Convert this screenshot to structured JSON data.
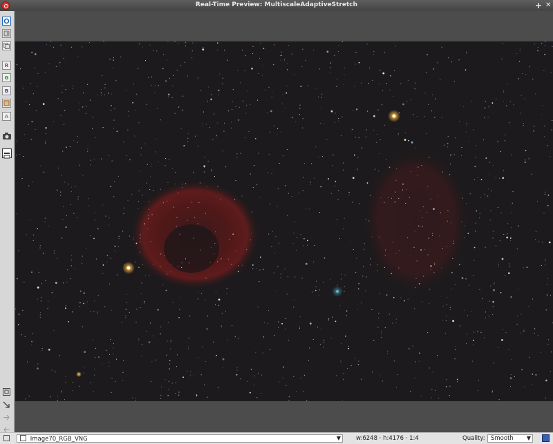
{
  "window": {
    "title": "Real-Time Preview: MultiscaleAdaptiveStretch"
  },
  "titlebar_buttons": {
    "pin": "+",
    "close": "✕"
  },
  "toolbar": {
    "tools": [
      {
        "name": "zoom-fit-tool",
        "label": ""
      },
      {
        "name": "view-split-tool",
        "label": ""
      },
      {
        "name": "view-compare-tool",
        "label": ""
      },
      {
        "name": "channel-r-tool",
        "label": "R"
      },
      {
        "name": "channel-g-tool",
        "label": "G"
      },
      {
        "name": "channel-b-tool",
        "label": "B"
      },
      {
        "name": "channel-rgb-tool",
        "label": ""
      },
      {
        "name": "channel-alpha-tool",
        "label": "A"
      }
    ]
  },
  "status": {
    "view_selector": "Image70_RGB_VNG",
    "dimensions": "w:6248 · h:4176 · 1:4",
    "quality_label": "Quality:",
    "quality_value": "Smooth"
  },
  "colors": {
    "nebula": "#7a1c1c",
    "sky": "#1c1a1c",
    "accent": "#1a5fb4"
  }
}
